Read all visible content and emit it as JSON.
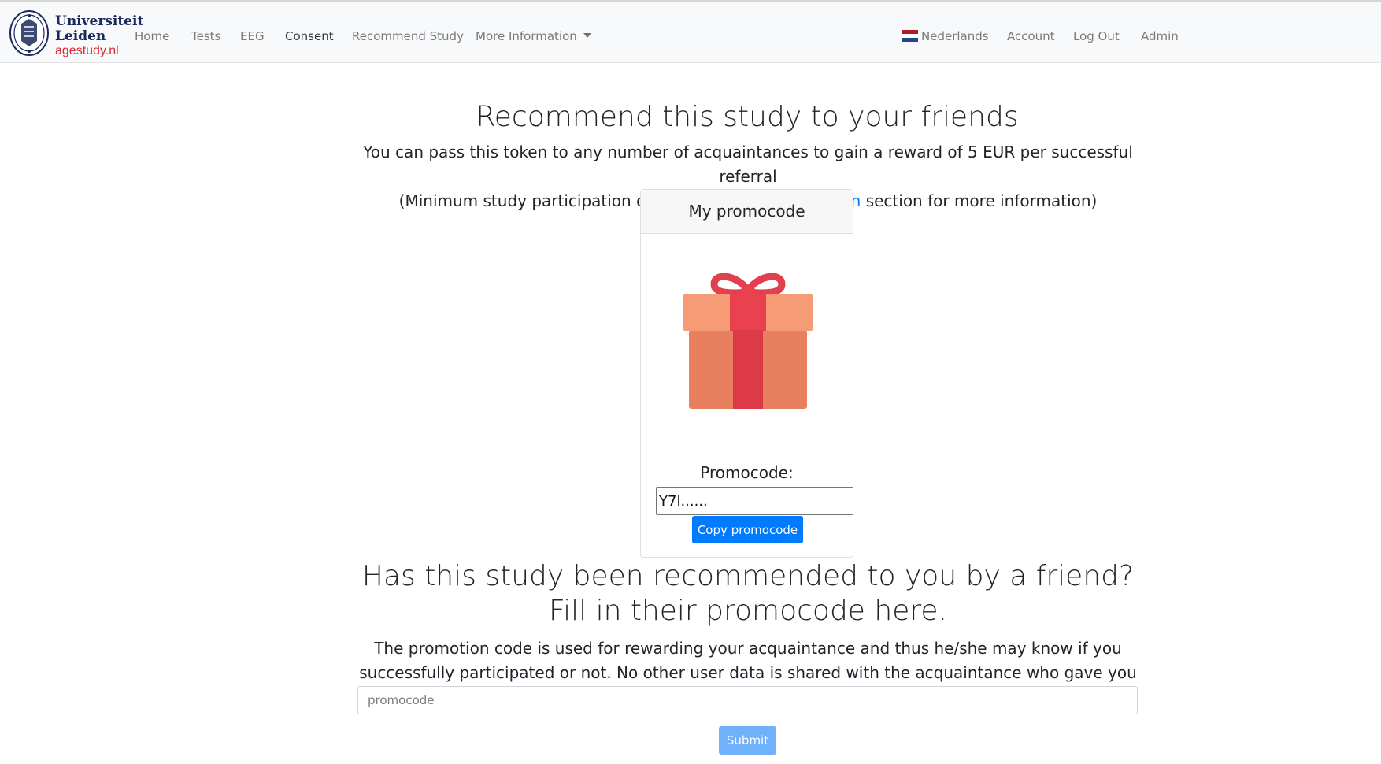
{
  "brand": {
    "university_line1": "Universiteit",
    "university_line2": "Leiden",
    "site": "agestudy.nl"
  },
  "nav": {
    "items": [
      {
        "label": "Home",
        "active": false
      },
      {
        "label": "Tests",
        "active": false
      },
      {
        "label": "EEG",
        "active": false
      },
      {
        "label": "Consent",
        "active": true
      },
      {
        "label": "Recommend Study",
        "active": false
      },
      {
        "label": "More Information",
        "active": false,
        "dropdown": true
      }
    ],
    "right": [
      {
        "label": "Nederlands",
        "icon": "netherlands-flag-icon"
      },
      {
        "label": "Account"
      },
      {
        "label": "Log Out"
      },
      {
        "label": "Admin"
      }
    ]
  },
  "main": {
    "title": "Recommend this study to your friends",
    "lead_line1": "You can pass this token to any number of acquaintances to gain a reward of 5 EUR per successful referral",
    "lead_line2_prefix": "(Minimum study participation of 1 year. See ",
    "lead_link": "compensation",
    "lead_line2_suffix": " section for more information)"
  },
  "card": {
    "header": "My promocode",
    "icon": "gift-icon",
    "promo_label": "Promocode:",
    "promo_value": "Y7l......",
    "copy_button": "Copy promocode"
  },
  "referral": {
    "question": "Has this study been recommended to you by a friend? Fill in their promocode here.",
    "description": "The promotion code is used for rewarding your acquaintance and thus he/she may know if you successfully participated or not. No other user data is shared with the acquaintance who gave you this code.",
    "input_placeholder": "promocode",
    "submit_button": "Submit"
  },
  "colors": {
    "primary": "#007bff",
    "primary_disabled": "#6fb1fb",
    "brand_red": "#e3262f",
    "brand_navy": "#1b2a5e"
  }
}
